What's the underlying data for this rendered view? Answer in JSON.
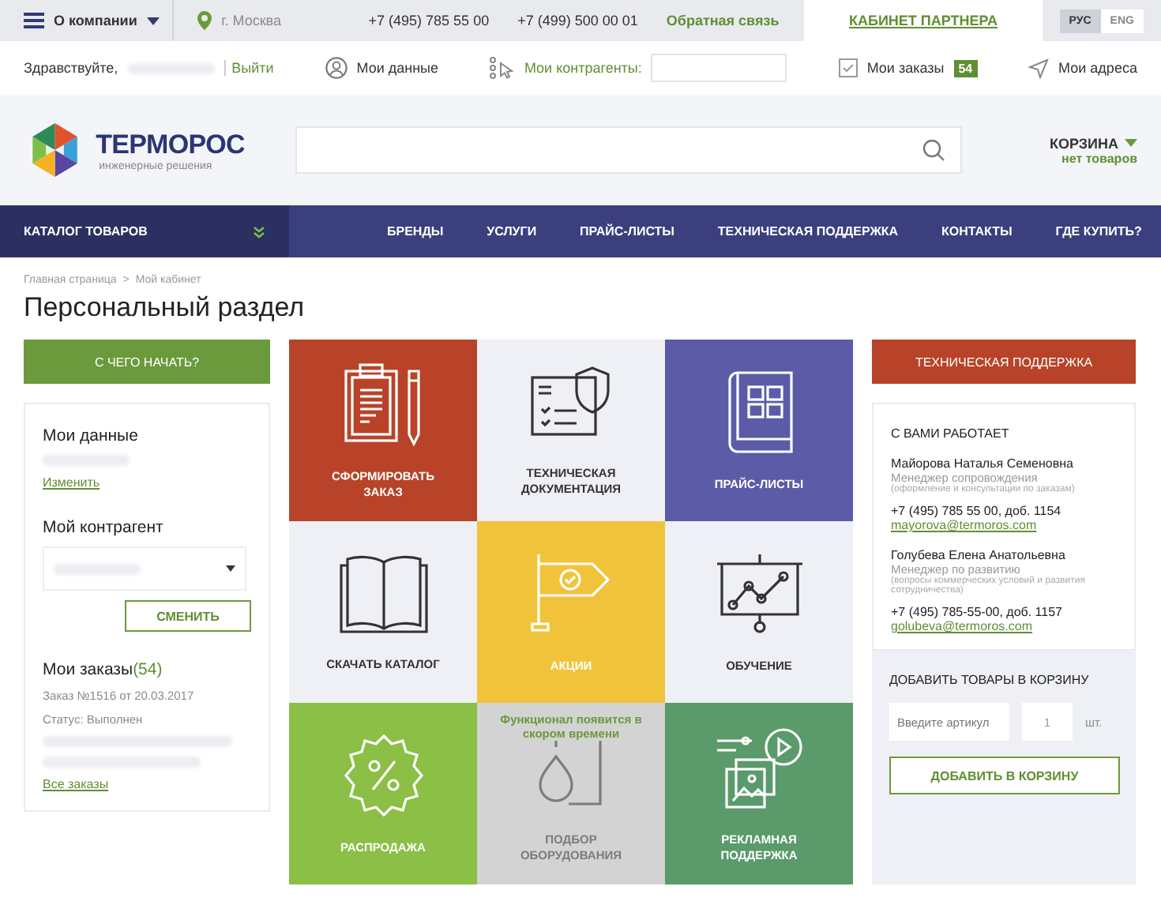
{
  "top_bar": {
    "menu_label": "О компании",
    "city": "г. Москва",
    "phones": [
      "+7 (495) 785 55 00",
      "+7 (499) 500 00 01"
    ],
    "feedback": "Обратная связь",
    "partner": "КАБИНЕТ ПАРТНЕРА",
    "languages": [
      {
        "label": "РУС",
        "selected": true
      },
      {
        "label": "ENG",
        "selected": false
      }
    ]
  },
  "user_bar": {
    "greeting": "Здравствуйте,",
    "logout": "Выйти",
    "my_data": "Мои данные",
    "counterparties_label": "Мои контрагенты:",
    "orders": "Мои заказы",
    "orders_badge": "54",
    "addresses": "Мои адреса"
  },
  "header": {
    "logo_name": "ТЕРМОРОС",
    "logo_tagline": "инженерные решения",
    "cart_title": "КОРЗИНА",
    "cart_status": "нет товаров"
  },
  "nav": {
    "catalog": "КАТАЛОГ ТОВАРОВ",
    "items": [
      "БРЕНДЫ",
      "УСЛУГИ",
      "ПРАЙС-ЛИСТЫ",
      "ТЕХНИЧЕСКАЯ ПОДДЕРЖКА",
      "КОНТАКТЫ",
      "ГДЕ КУПИТЬ?"
    ]
  },
  "breadcrumbs": [
    "Главная страница",
    "Мой кабинет"
  ],
  "breadcrumb_separator": ">",
  "page_title": "Персональный раздел",
  "left": {
    "start_button": "С ЧЕГО НАЧАТЬ?",
    "my_data_title": "Мои данные",
    "edit_link": "Изменить",
    "counterparty_title": "Мой контрагент",
    "change_button": "СМЕНИТЬ",
    "orders_title": "Мои заказы",
    "orders_count": "(54)",
    "last_order": "Заказ №1516 от 20.03.2017",
    "order_status": "Статус: Выполнен",
    "all_orders": "Все заказы"
  },
  "tiles": [
    {
      "label": "СФОРМИРОВАТЬ ЗАКАЗ",
      "color": "#b84328",
      "disabled": false
    },
    {
      "label": "ТЕХНИЧЕСКАЯ ДОКУМЕНТАЦИЯ",
      "color": "#eef0f5",
      "disabled": false
    },
    {
      "label": "ПРАЙС-ЛИСТЫ",
      "color": "#5b5ba8",
      "disabled": false
    },
    {
      "label": "СКАЧАТЬ КАТАЛОГ",
      "color": "#eef0f5",
      "disabled": false
    },
    {
      "label": "АКЦИИ",
      "color": "#f1c33b",
      "disabled": false
    },
    {
      "label": "ОБУЧЕНИЕ",
      "color": "#eef0f5",
      "disabled": false
    },
    {
      "label": "РАСПРОДАЖА",
      "color": "#8bbf45",
      "disabled": false
    },
    {
      "label": "ПОДБОР ОБОРУДОВАНИЯ",
      "color": "#d3d3d3",
      "disabled": true,
      "notice": "Функционал появится в скором времени"
    },
    {
      "label": "РЕКЛАМНАЯ ПОДДЕРЖКА",
      "color": "#5a9a6b",
      "disabled": false
    }
  ],
  "right": {
    "support_button": "ТЕХНИЧЕСКАЯ ПОДДЕРЖКА",
    "working_title": "С ВАМИ РАБОТАЕТ",
    "managers": [
      {
        "name": "Майорова Наталья Семеновна",
        "role": "Менеджер сопровождения",
        "note": "(оформление и консультации по заказам)",
        "phone": "+7 (495) 785 55 00, доб. 1154",
        "email": "mayorova@termoros.com"
      },
      {
        "name": "Голубева Елена Анатольевна",
        "role": "Менеджер по развитию",
        "note": "(вопросы коммерческих условий и развития сотрудничества)",
        "phone": "+7 (495) 785-55-00, доб. 1157",
        "email": "golubeva@termoros.com"
      }
    ],
    "add_title": "ДОБАВИТЬ ТОВАРЫ В КОРЗИНУ",
    "article_placeholder": "Введите артикул",
    "quantity": "1",
    "unit": "шт.",
    "add_button": "ДОБАВИТЬ В КОРЗИНУ"
  }
}
